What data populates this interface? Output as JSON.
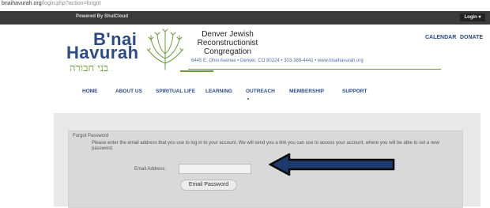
{
  "browser": {
    "url_domain": "bnaihavurah.org",
    "url_path": "/login.php?action=forgot"
  },
  "topbar": {
    "powered_by": "Powered By ShulCloud",
    "login_label": "Login ▾"
  },
  "brand": {
    "line1": "B'nai",
    "line2": "Havurah",
    "hebrew": "בני חבורה",
    "logo_icon": "menorah-tree-icon"
  },
  "org": {
    "name_lines": [
      "Denver Jewish",
      "Reconstructionist",
      "Congregation"
    ],
    "address": "6445 E. Ohio Avenue • Denver, CO 80224 • 303-388-4441 • www.bnaihavurah.org"
  },
  "top_links": [
    "CALENDAR",
    "DONATE"
  ],
  "nav": [
    "HOME",
    "ABOUT US",
    "SPIRITUAL LIFE",
    "LEARNING",
    "OUTREACH",
    "MEMBERSHIP",
    "SUPPORT"
  ],
  "forgot": {
    "title": "Forgot Password",
    "instructions": "Please enter the email address that you use to log in to your account. We will send you a link you can use to access your account, where you will be able to set a new password.",
    "email_label": "Email Address:",
    "email_value": "",
    "button_label": "Email Password"
  },
  "annotation": {
    "icon": "left-arrow-icon",
    "fill": "#1d3a6e",
    "outline": "#0a0a0a"
  },
  "colors": {
    "brand_blue": "#2b4a86",
    "brand_green": "#6a9b3a",
    "topbar": "#3b3b3b"
  }
}
